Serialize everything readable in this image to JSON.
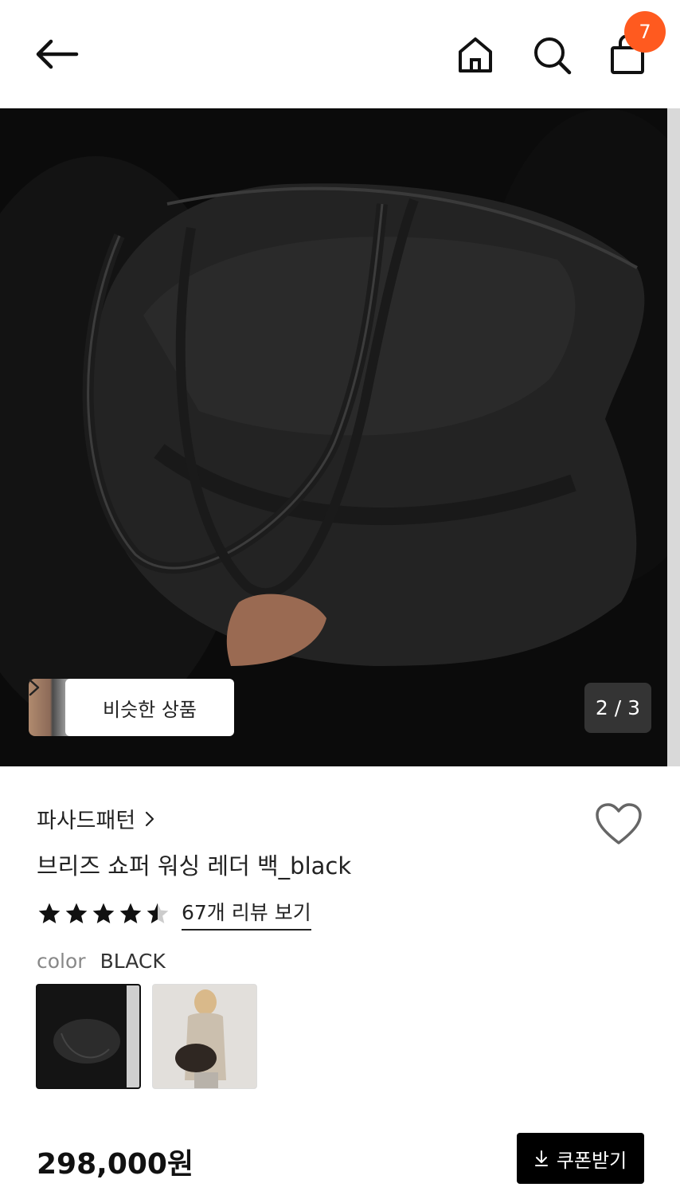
{
  "header": {
    "cart_count": "7"
  },
  "gallery": {
    "similar_label": "비슷한 상품",
    "pager": "2 / 3"
  },
  "product": {
    "brand": "파사드패턴",
    "title": "브리즈 쇼퍼 워싱 레더 백_black",
    "rating": 4.5,
    "review_link": "67개 리뷰 보기",
    "color_label": "color",
    "color_value": "BLACK",
    "price": "298,000원",
    "coupon_label": "쿠폰받기"
  },
  "colors": {
    "badge": "#ff5a1f",
    "primary": "#000000"
  }
}
